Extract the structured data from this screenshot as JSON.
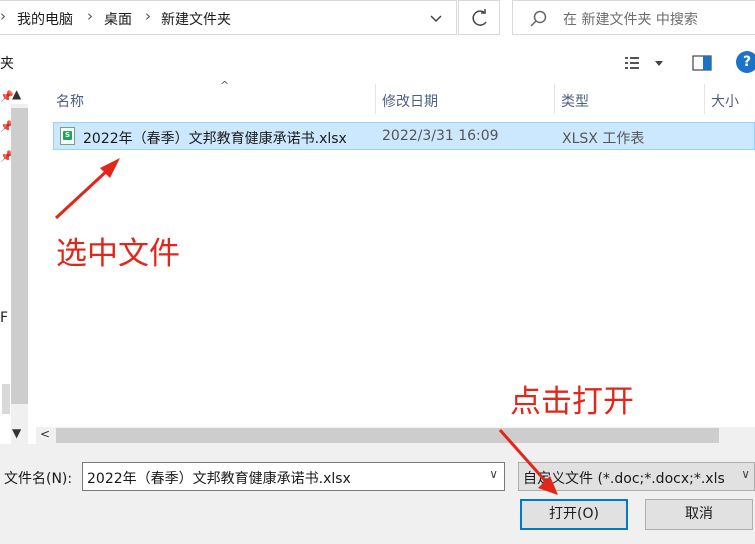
{
  "address": {
    "crumbs": [
      "我的电脑",
      "桌面",
      "新建文件夹"
    ],
    "search_placeholder": "在 新建文件夹 中搜索"
  },
  "toolbar": {
    "cut_text": "夹",
    "help_label": "?"
  },
  "nav": {
    "partial_label": "F"
  },
  "columns": {
    "name": "名称",
    "modified": "修改日期",
    "type": "类型",
    "size": "大小"
  },
  "files": [
    {
      "name": "2022年（春季）文邦教育健康承诺书.xlsx",
      "modified": "2022/3/31 16:09",
      "type": "XLSX 工作表",
      "icon": "xlsx-file-icon",
      "selected": true
    }
  ],
  "bottom": {
    "filename_label": "文件名(N):",
    "filename_value": "2022年（春季）文邦教育健康承诺书.xlsx",
    "filter_value": "自定义文件 (*.doc;*.docx;*.xls",
    "open_label": "打开(O)",
    "cancel_label": "取消"
  },
  "annotations": {
    "select_file": "选中文件",
    "click_open": "点击打开",
    "color": "#e2261a"
  },
  "colors": {
    "selection_bg": "#cce8ff",
    "selection_border": "#99d1ff",
    "primary_button_border": "#0078d7"
  }
}
